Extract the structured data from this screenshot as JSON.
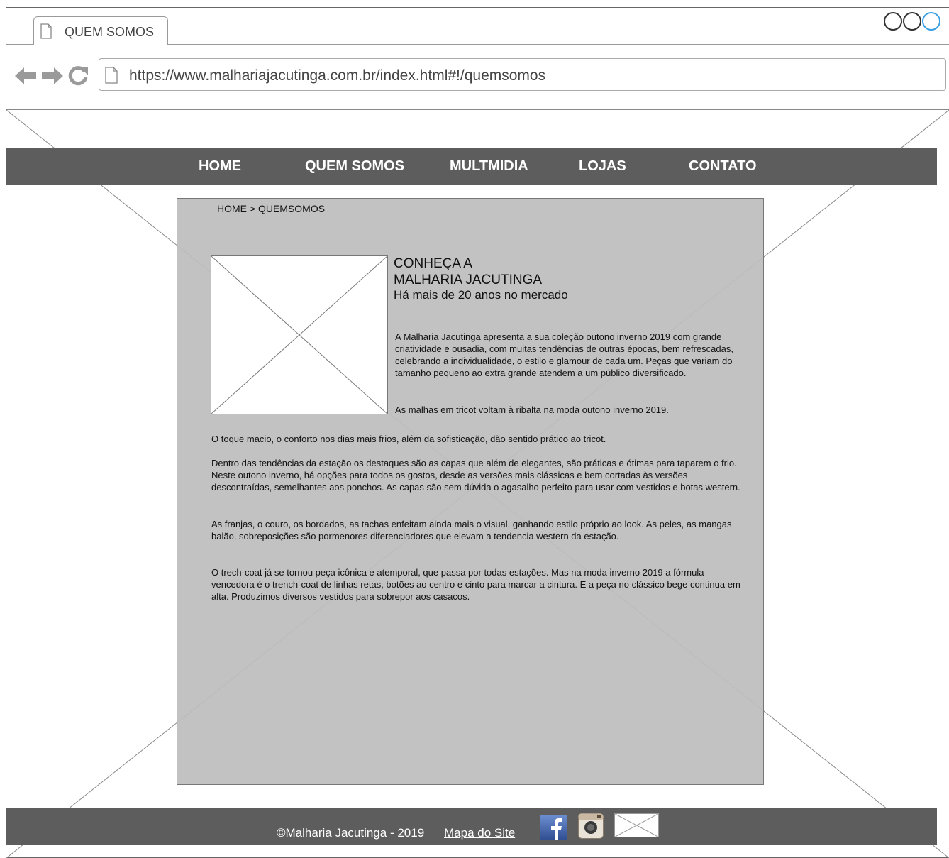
{
  "browser": {
    "tab_title": "QUEM SOMOS",
    "url": "https://www.malhariajacutinga.com.br/index.html#!/quemsomos"
  },
  "nav": {
    "items": [
      "HOME",
      "QUEM SOMOS",
      "MULTMIDIA",
      "LOJAS",
      "CONTATO"
    ]
  },
  "content": {
    "breadcrumb": "HOME > QUEMSOMOS",
    "title_line1": "CONHEÇA A",
    "title_line2": "MALHARIA JACUTINGA",
    "subtitle": "Há mais de 20 anos no mercado",
    "intro_paragraphs": [
      "A Malharia Jacutinga apresenta a sua coleção outono inverno 2019 com grande criatividade e ousadia, com muitas tendências de outras épocas, bem refrescadas, celebrando a individualidade, o estilo e glamour de cada um. Peças que variam do tamanho pequeno ao extra grande atendem a um público diversificado.",
      "As malhas em tricot voltam à ribalta na moda outono inverno 2019."
    ],
    "body_paragraphs": [
      "O toque macio, o conforto nos dias mais frios, além da sofisticação, dão sentido prático ao tricot.",
      "Dentro das tendências da estação os destaques são as capas que além de elegantes, são práticas e ótimas para taparem o frio. Neste outono inverno, há opções para todos os gostos, desde as versões mais clássicas e bem cortadas às versões descontraídas, semelhantes aos ponchos. As capas são sem dúvida o agasalho perfeito para usar com vestidos e botas western.",
      "As franjas, o couro, os bordados, as tachas enfeitam ainda mais o visual, ganhando estilo próprio ao look. As peles, as mangas balão, sobreposições são pormenores diferenciadores que elevam a tendencia western da estação.",
      "O trech-coat já se tornou peça icônica e atemporal, que passa por todas estações. Mas na moda inverno 2019 a fórmula vencedora é o trench-coat de linhas retas, botões ao centro e cinto para marcar a cintura. E a peça no clássico bege continua em alta. Produzimos diversos vestidos para sobrepor aos casacos."
    ]
  },
  "footer": {
    "copyright": "©Malharia Jacutinga - 2019",
    "sitemap": "Mapa do Site"
  },
  "colors": {
    "bar": "#5d5d5d",
    "content_bg": "#bdbdbd",
    "facebook": "#3b5998",
    "window_accent": "#3aa0e6"
  }
}
